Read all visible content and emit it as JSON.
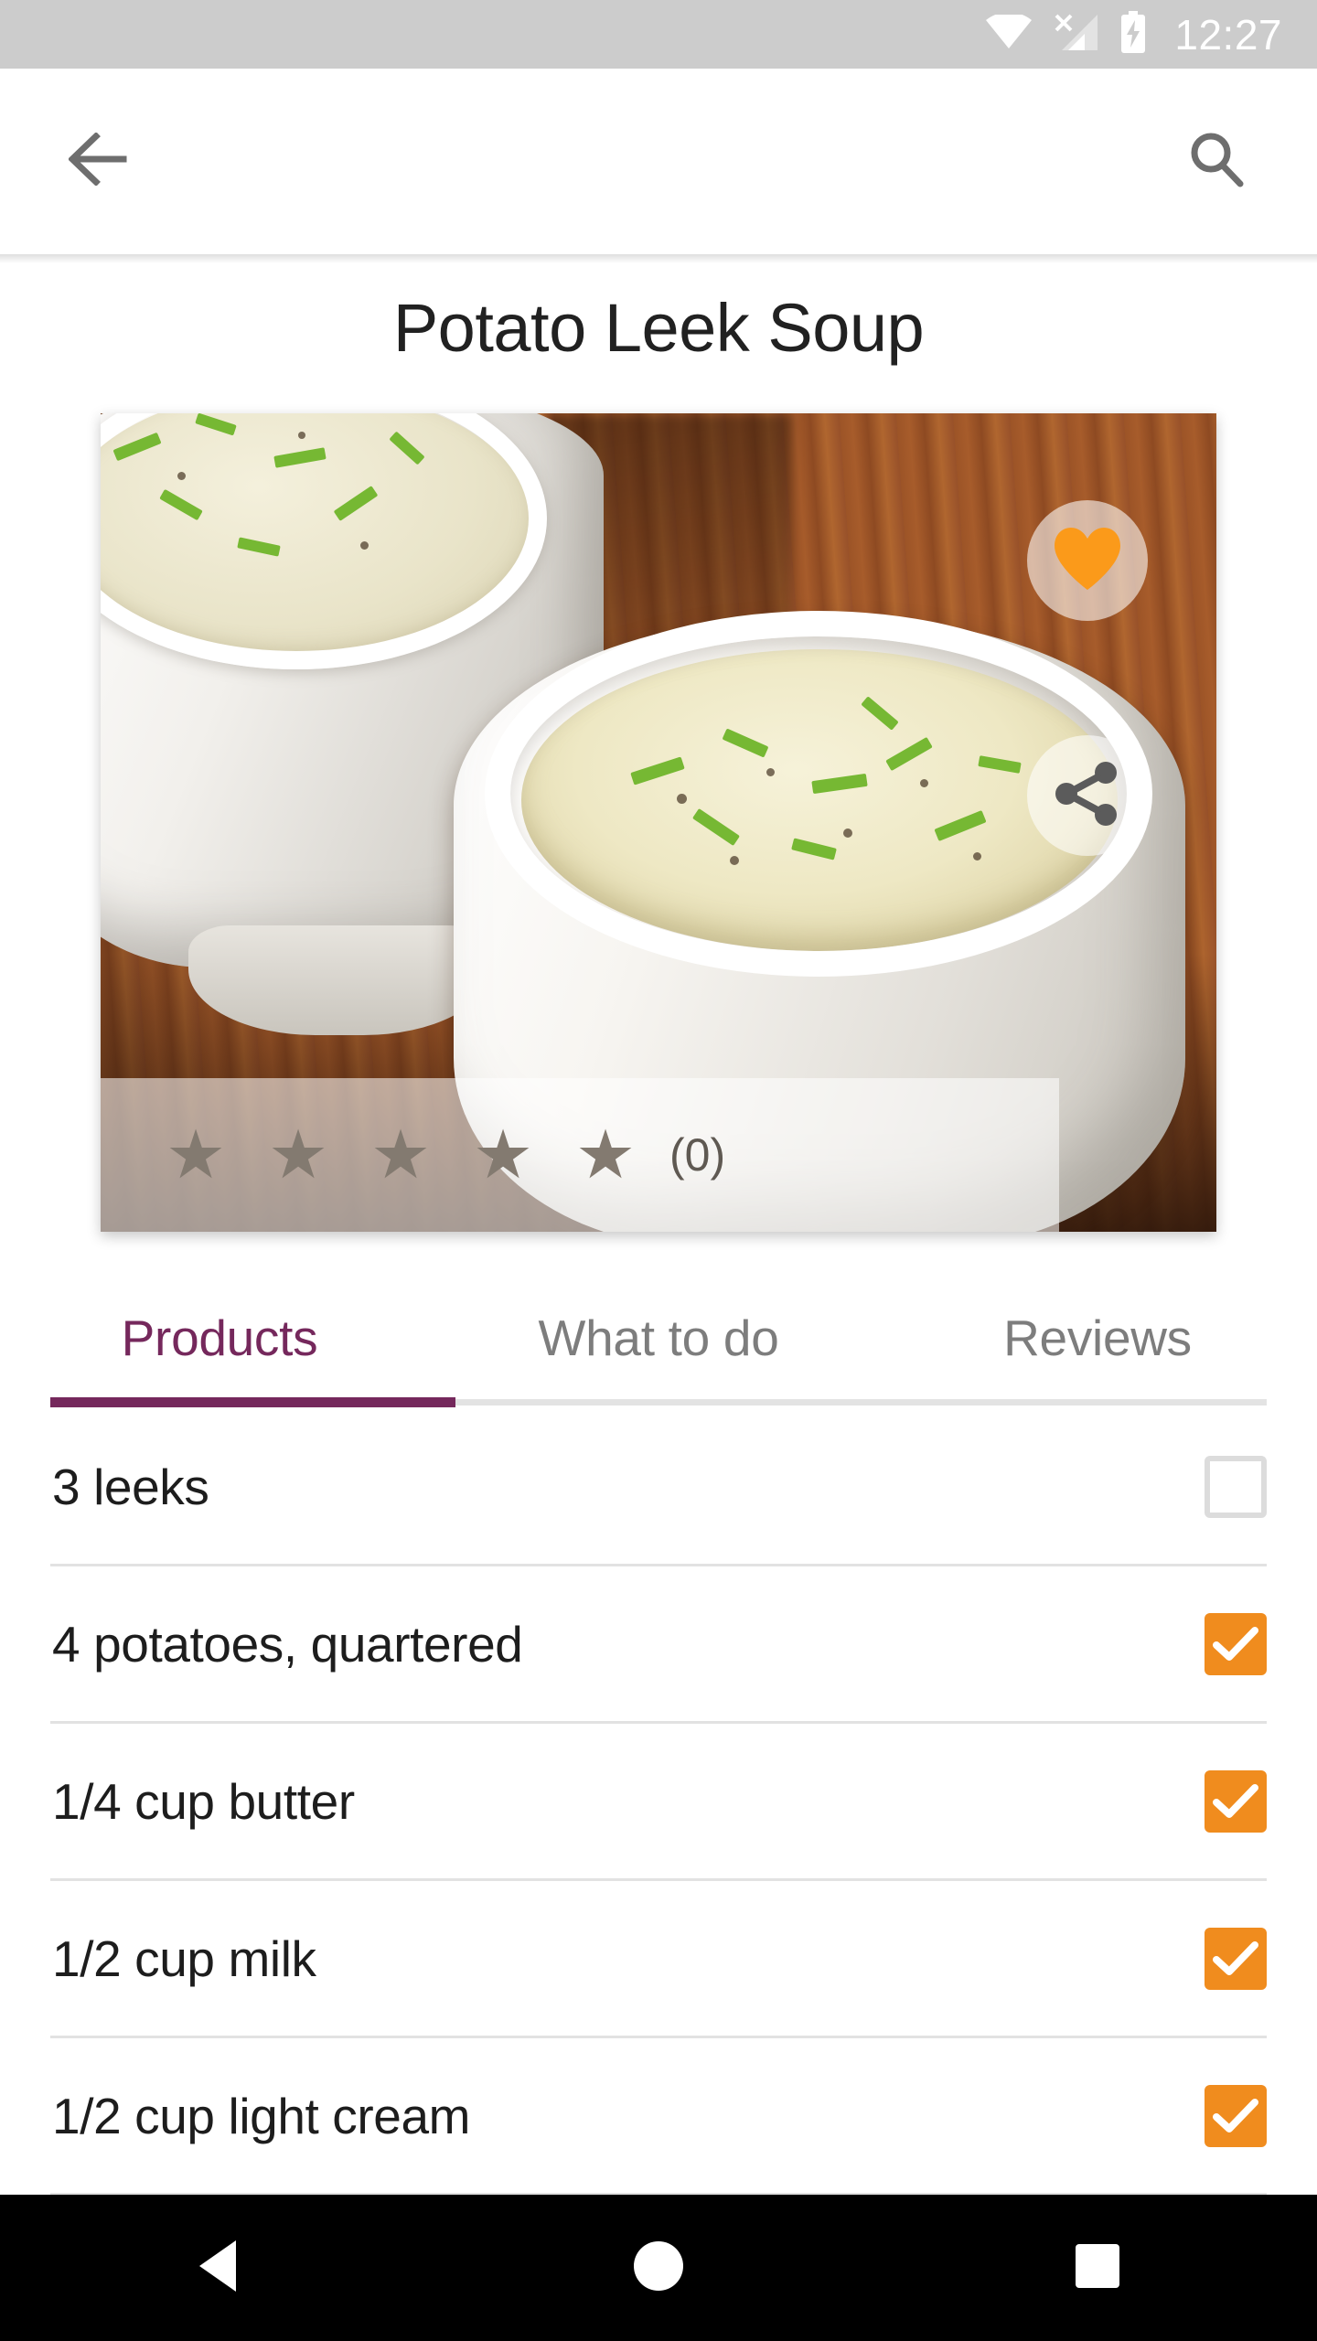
{
  "status_bar": {
    "time": "12:27",
    "icons": [
      "wifi-icon",
      "cellular-no-sim-icon",
      "battery-charging-icon"
    ],
    "background_color": "#cccccc",
    "foreground_color": "#ffffff"
  },
  "app_bar": {
    "back_icon": "back-arrow-icon",
    "search_icon": "search-icon",
    "icon_color": "#6e6e6e"
  },
  "recipe": {
    "title": "Potato Leek Soup",
    "image_alt": "Two white ceramic bowls of creamy potato leek soup garnished with chopped green chives and cracked pepper, on a rustic wooden table",
    "favorite_icon": "heart-icon",
    "favorite_active": true,
    "favorite_color": "#fb9a1a",
    "share_icon": "share-icon",
    "share_color": "#5b5b5b",
    "rating": {
      "stars_total": 5,
      "stars_filled": 0,
      "star_icon": "star-icon",
      "count_label": "(0)",
      "star_color": "#837a70"
    }
  },
  "tabs": {
    "active_index": 0,
    "active_color": "#75285c",
    "inactive_color": "#7d7d7d",
    "items": [
      {
        "label": "Products"
      },
      {
        "label": "What to do"
      },
      {
        "label": "Reviews"
      }
    ]
  },
  "ingredients": {
    "checkbox_checked_color": "#f08c1e",
    "checkbox_unchecked_border": "#dcdcdc",
    "items": [
      {
        "label": "3 leeks",
        "checked": false
      },
      {
        "label": "4 potatoes, quartered",
        "checked": true
      },
      {
        "label": "1/4 cup butter",
        "checked": true
      },
      {
        "label": "1/2 cup milk",
        "checked": true
      },
      {
        "label": "1/2 cup light cream",
        "checked": true
      }
    ]
  },
  "nav_bar": {
    "background_color": "#000000",
    "buttons": [
      {
        "icon": "nav-back-triangle-icon"
      },
      {
        "icon": "nav-home-circle-icon"
      },
      {
        "icon": "nav-recents-square-icon"
      }
    ]
  }
}
